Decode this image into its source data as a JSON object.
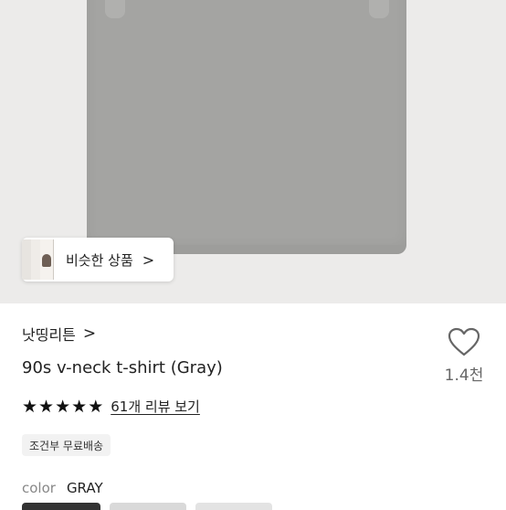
{
  "similar": {
    "label": "비슷한 상품",
    "chevron": "›"
  },
  "store": {
    "name": "낫띵리튼",
    "chevron": ">"
  },
  "product": {
    "title": "90s v-neck t-shirt (Gray)"
  },
  "rating": {
    "stars": 5,
    "review_link": "61개 리뷰 보기"
  },
  "shipping": {
    "badge": "조건부 무료배송"
  },
  "option": {
    "key": "color",
    "value": "GRAY"
  },
  "like": {
    "icon": "heart-outline-icon",
    "count": "1.4천"
  },
  "colors": {
    "shirt": "#a4a4a2",
    "background": "#ecebea",
    "star": "#111111"
  }
}
